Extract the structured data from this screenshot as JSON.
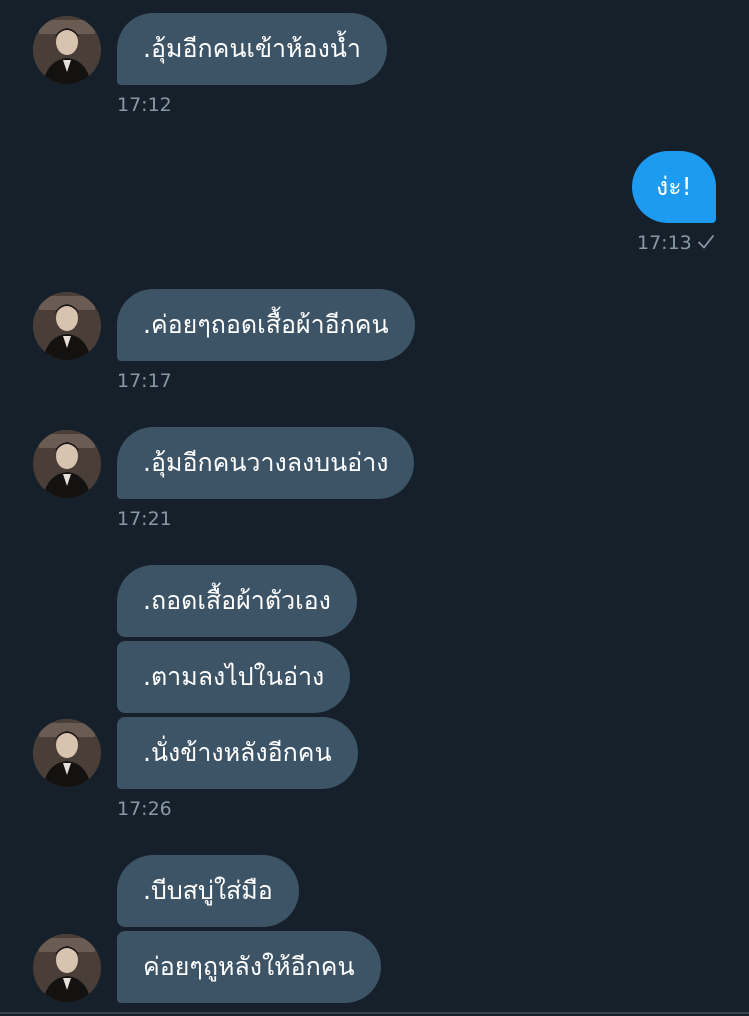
{
  "messages": [
    {
      "text": ".อุ้มอีกคนเข้าห้องน้ำ",
      "side": "incoming"
    },
    {
      "text": "ง่ะ!",
      "side": "outgoing"
    },
    {
      "text": ".ค่อยๆถอดเสื้อผ้าอีกคน",
      "side": "incoming"
    },
    {
      "text": ".อุ้มอีกคนวางลงบนอ่าง",
      "side": "incoming"
    },
    {
      "text": ".ถอดเสื้อผ้าตัวเอง",
      "side": "incoming"
    },
    {
      "text": ".ตามลงไปในอ่าง",
      "side": "incoming"
    },
    {
      "text": ".นั่งข้างหลังอีกคน",
      "side": "incoming"
    },
    {
      "text": ".บีบสบู่ใส่มือ",
      "side": "incoming"
    },
    {
      "text": "ค่อยๆถูหลังให้อีกคน",
      "side": "incoming"
    }
  ],
  "timestamps": [
    "17:12",
    "17:13",
    "17:17",
    "17:21",
    "17:26"
  ],
  "read_receipt_icon": "checkmark-icon",
  "avatar_icon": "contact-avatar",
  "colors": {
    "background": "#15202b",
    "incoming_bubble": "#3d5466",
    "outgoing_bubble": "#1d9bf0",
    "timestamp": "#8899a6"
  }
}
